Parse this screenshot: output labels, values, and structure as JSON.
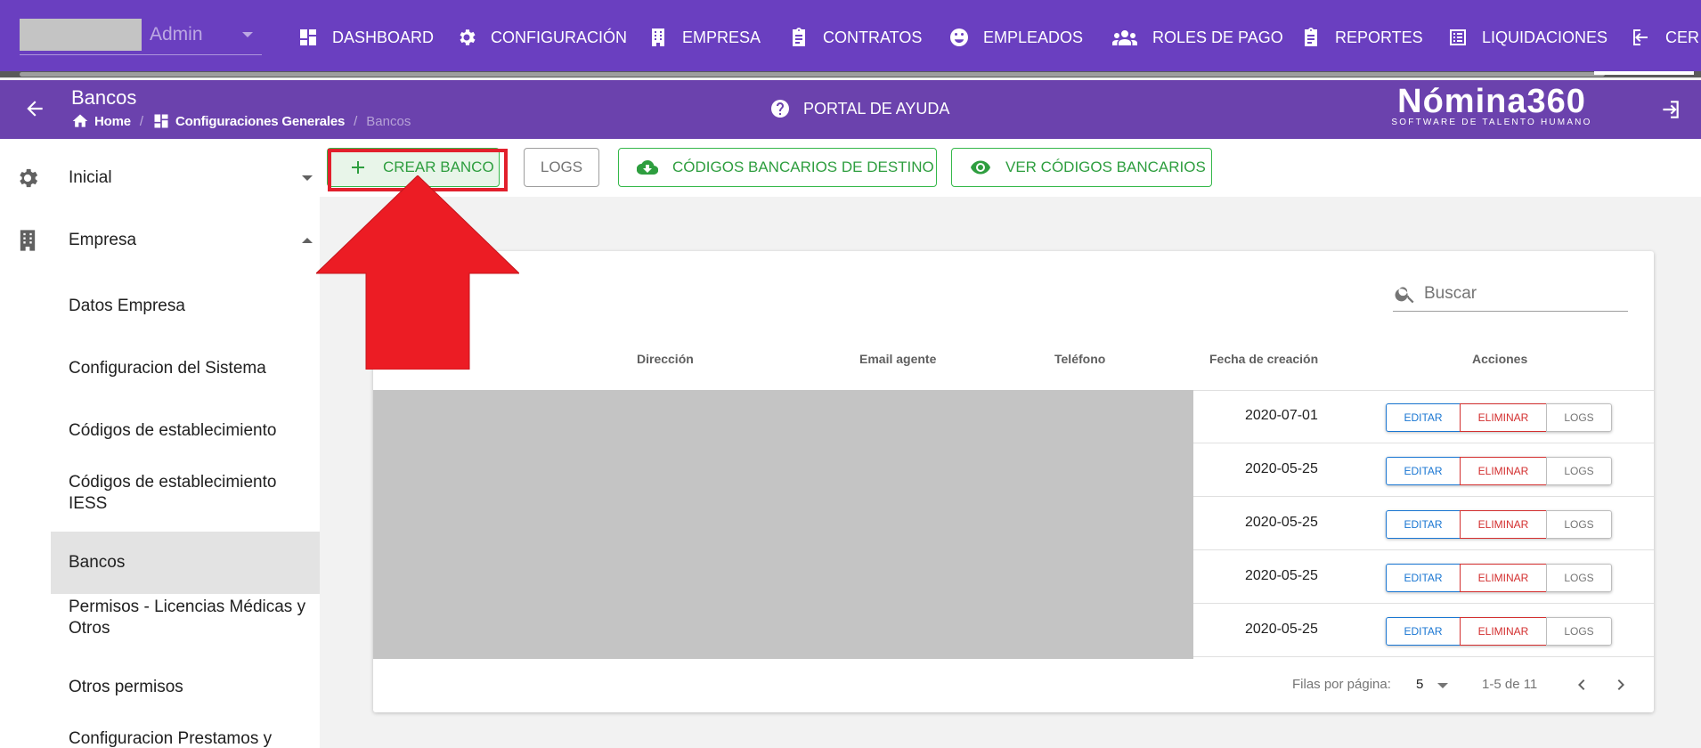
{
  "topnav": {
    "user_name": "Admin",
    "items": [
      {
        "label": "DASHBOARD",
        "icon": "dashboard-icon"
      },
      {
        "label": "CONFIGURACIÓN",
        "icon": "gear-icon"
      },
      {
        "label": "EMPRESA",
        "icon": "building-icon"
      },
      {
        "label": "CONTRATOS",
        "icon": "clipboard-icon"
      },
      {
        "label": "EMPLEADOS",
        "icon": "face-icon"
      },
      {
        "label": "ROLES DE PAGO",
        "icon": "users-icon"
      },
      {
        "label": "REPORTES",
        "icon": "clipboard-icon"
      },
      {
        "label": "LIQUIDACIONES",
        "icon": "list-icon"
      },
      {
        "label": "CER",
        "icon": "logout-icon"
      }
    ]
  },
  "subheader": {
    "title": "Bancos",
    "breadcrumb": [
      {
        "label": "Home",
        "icon": "home-icon"
      },
      {
        "label": "Configuraciones Generales",
        "icon": "dashboard-icon"
      },
      {
        "label": "Bancos"
      }
    ],
    "help_label": "PORTAL DE AYUDA",
    "brand_name": "Nómina360",
    "brand_tagline": "SOFTWARE DE TALENTO HUMANO"
  },
  "sidebar": {
    "groups": [
      {
        "label": "Inicial",
        "icon": "gear-icon",
        "expanded": false
      },
      {
        "label": "Empresa",
        "icon": "building-icon",
        "expanded": true
      }
    ],
    "items": [
      {
        "label": "Datos Empresa"
      },
      {
        "label": "Configuracion del Sistema"
      },
      {
        "label": "Códigos de establecimiento"
      },
      {
        "label": "Códigos de establecimiento IESS"
      },
      {
        "label": "Bancos",
        "active": true
      },
      {
        "label": "Permisos - Licencias Médicas y Otros"
      },
      {
        "label": "Otros permisos"
      },
      {
        "label": "Configuracion Prestamos y"
      }
    ]
  },
  "toolbar": {
    "crear_label": "CREAR BANCO",
    "logs_label": "LOGS",
    "codigos_label": "CÓDIGOS BANCARIOS DE DESTINO",
    "ver_label": "VER CÓDIGOS BANCARIOS"
  },
  "table": {
    "search_placeholder": "Buscar",
    "columns": [
      "Dirección",
      "Email agente",
      "Teléfono",
      "Fecha de creación",
      "Acciones"
    ],
    "rows": [
      {
        "fecha": "2020-07-01"
      },
      {
        "fecha": "2020-05-25"
      },
      {
        "fecha": "2020-05-25"
      },
      {
        "fecha": "2020-05-25"
      },
      {
        "fecha": "2020-05-25"
      }
    ],
    "action_labels": {
      "edit": "EDITAR",
      "delete": "ELIMINAR",
      "logs": "LOGS"
    },
    "pagination": {
      "rows_per_page_label": "Filas por página:",
      "rows_per_page": "5",
      "range": "1-5 de 11"
    }
  },
  "colors": {
    "nav_bg": "#6a3fc0",
    "subheader_bg": "#6b42ad",
    "accent_green": "#35b84a",
    "annotation_red": "#e2202c"
  }
}
